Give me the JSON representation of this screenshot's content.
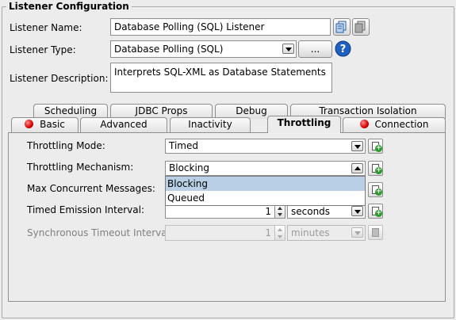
{
  "group": {
    "title": "Listener Configuration"
  },
  "listener": {
    "name_label": "Listener Name:",
    "name_value": "Database Polling (SQL) Listener",
    "type_label": "Listener Type:",
    "type_value": "Database Polling (SQL)",
    "type_browse_label": "...",
    "description_label": "Listener Description:",
    "description_value": "Interprets SQL-XML as Database Statements"
  },
  "tabs": {
    "row_back": [
      {
        "label": "Scheduling"
      },
      {
        "label": "JDBC Props"
      },
      {
        "label": "Debug"
      },
      {
        "label": "Transaction Isolation"
      }
    ],
    "row_front": [
      {
        "label": "Basic",
        "error": true
      },
      {
        "label": "Advanced",
        "error": false
      },
      {
        "label": "Inactivity",
        "error": false
      },
      {
        "label": "Throttling",
        "error": false,
        "active": true
      },
      {
        "label": "Connection",
        "error": true
      }
    ]
  },
  "throttling": {
    "mode_label": "Throttling Mode:",
    "mode_value": "Timed",
    "mechanism_label": "Throttling Mechanism:",
    "mechanism_value": "Blocking",
    "mechanism_options": [
      "Blocking",
      "Queued"
    ],
    "mechanism_selected": "Blocking",
    "max_concurrent_label": "Max Concurrent Messages:",
    "emission_label": "Timed Emission Interval:",
    "emission_value": "1",
    "emission_unit": "seconds",
    "sync_timeout_label": "Synchronous Timeout Interval:",
    "sync_timeout_value": "1",
    "sync_timeout_unit": "minutes"
  },
  "icons": {
    "copy": "copy-icon",
    "paste": "paste-icon",
    "help": "help-icon",
    "error": "error-dot-icon",
    "add": "add-icon"
  },
  "colors": {
    "error_dot": "#d40000",
    "help_blue": "#1f5fbf",
    "selection": "#b8cfe5",
    "add_green": "#2a9a2a"
  }
}
